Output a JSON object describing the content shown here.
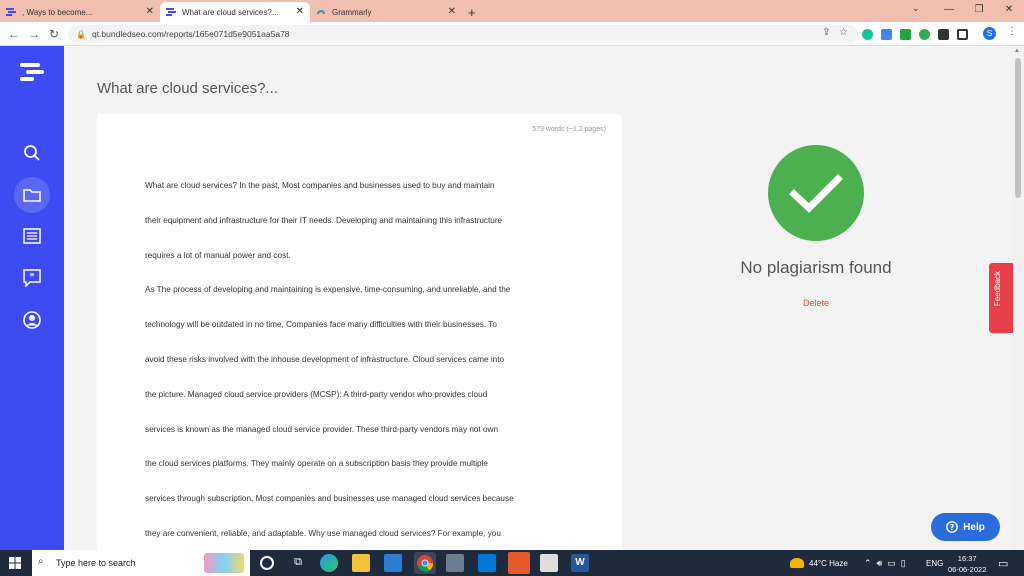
{
  "browser": {
    "tabs": [
      {
        "title": ", Ways to become..."
      },
      {
        "title": "What are cloud services?..."
      },
      {
        "title": "Grammarly"
      }
    ],
    "new_tab": "+",
    "url": "qt.bundledseo.com/reports/165e071d5e9051aa5a78",
    "profile_initial": "S"
  },
  "page": {
    "title": "What are cloud services?...",
    "word_count": "579 words (~1.2 pages)",
    "paragraphs": [
      [
        "What are cloud services? In the past, Most companies and businesses used to buy and maintain",
        "their equipment and infrastructure for their IT needs. Developing and maintaining this infrastructure",
        "requires a lot of manual power and cost."
      ],
      [
        "As The process of developing and maintaining is expensive, time-consuming, and unreliable, and the",
        "technology will be outdated in no time, Companies face many difficulties with their businesses. To",
        "avoid these risks involved with the inhouse development of infrastructure. Cloud services came into",
        "the picture. Managed cloud service providers (MCSP): A third-party vendor who provides cloud",
        "services is known as the managed cloud service provider. These third-party vendors may not own",
        "the cloud services platforms. They mainly operate on a subscription basis they provide multiple",
        "services through subscription. Most companies and businesses use managed cloud services because",
        "they are convenient, reliable, and adaptable. Why use managed cloud services? For example, you"
      ]
    ],
    "result_text": "No plagiarism found",
    "delete_label": "Delete",
    "feedback_label": "Feedback",
    "help_label": "Help"
  },
  "taskbar": {
    "search_placeholder": "Type here to search",
    "weather": "44°C  Haze",
    "language": "ENG",
    "time": "16:37",
    "date": "06-06-2022"
  },
  "colors": {
    "sidebar": "#3d4cf2",
    "success": "#4caf50",
    "delete": "#e0523e",
    "help": "#2a6cdb",
    "feedback": "#e8404a",
    "tabbar": "#f1bfb0"
  }
}
